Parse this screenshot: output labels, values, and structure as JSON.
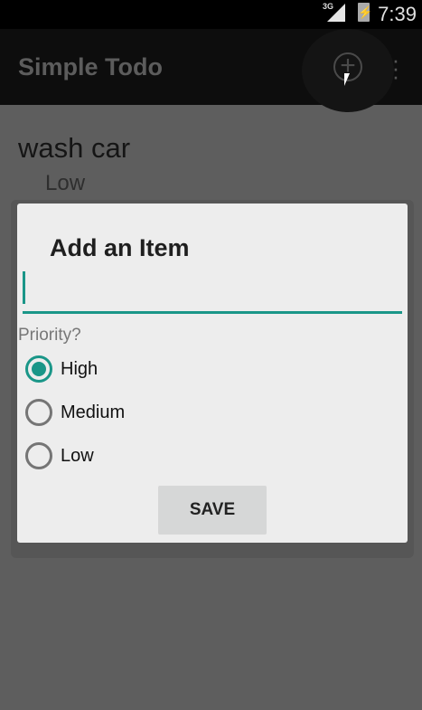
{
  "status_bar": {
    "network": "3G",
    "time": "7:39"
  },
  "app_bar": {
    "title": "Simple Todo",
    "add_icon": "plus-circle-icon",
    "more_icon": "more-vert-icon"
  },
  "list": [
    {
      "title": "wash car",
      "priority": "Low"
    }
  ],
  "dialog": {
    "title": "Add an Item",
    "input_value": "",
    "priority_label": "Priority?",
    "options": [
      {
        "label": "High",
        "selected": true
      },
      {
        "label": "Medium",
        "selected": false
      },
      {
        "label": "Low",
        "selected": false
      }
    ],
    "save_label": "SAVE"
  },
  "colors": {
    "accent": "#1a9688"
  }
}
